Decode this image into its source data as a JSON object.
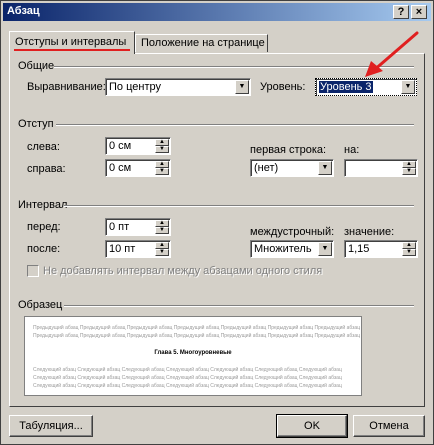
{
  "window": {
    "title": "Абзац",
    "help_button": "?",
    "close_button": "×"
  },
  "tabs": [
    {
      "label": "Отступы и интервалы",
      "active": true
    },
    {
      "label": "Положение на странице",
      "active": false
    }
  ],
  "general": {
    "heading": "Общие",
    "alignment_label": "Выравнивание:",
    "alignment_value": "По центру",
    "level_label": "Уровень:",
    "level_value": "Уровень 3"
  },
  "indent": {
    "heading": "Отступ",
    "left_label": "слева:",
    "left_value": "0 см",
    "right_label": "справа:",
    "right_value": "0 см",
    "first_line_label": "первая строка:",
    "first_line_value": "(нет)",
    "on_label": "на:",
    "on_value": ""
  },
  "spacing": {
    "heading": "Интервал",
    "before_label": "перед:",
    "before_value": "0 пт",
    "after_label": "после:",
    "after_value": "10 пт",
    "line_spacing_label": "междустрочный:",
    "line_spacing_value": "Множитель",
    "value_label": "значение:",
    "value_value": "1,15",
    "checkbox_label": "Не добавлять интервал между абзацами одного стиля",
    "checkbox_checked": false
  },
  "sample": {
    "heading": "Образец",
    "prev_text": "Предыдущий абзац Предыдущий абзац Предыдущий абзац Предыдущий абзац Предыдущий абзац Предыдущий абзац Предыдущий абзац",
    "main_text": "Глава 5. Многоуровневые",
    "next_text": "Следующий абзац Следующий абзац Следующий абзац Следующий абзац Следующий абзац Следующий абзац Следующий абзац"
  },
  "buttons": {
    "tabs": "Табуляция...",
    "ok": "OK",
    "cancel": "Отмена"
  },
  "colors": {
    "annotation_red": "#e02020",
    "titlebar": "#0a246a",
    "face": "#d4d0c8"
  }
}
